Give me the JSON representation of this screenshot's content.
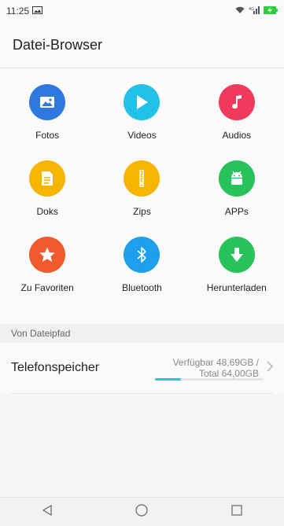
{
  "status": {
    "time": "11:25",
    "network_label": "4G"
  },
  "header": {
    "title": "Datei-Browser"
  },
  "categories": [
    {
      "label": "Fotos",
      "icon": "image-icon",
      "color": "#2f78e0"
    },
    {
      "label": "Videos",
      "icon": "play-icon",
      "color": "#22c2e8"
    },
    {
      "label": "Audios",
      "icon": "music-note-icon",
      "color": "#f0395b"
    },
    {
      "label": "Doks",
      "icon": "document-icon",
      "color": "#f7b500"
    },
    {
      "label": "Zips",
      "icon": "zip-icon",
      "color": "#f7b500"
    },
    {
      "label": "APPs",
      "icon": "android-icon",
      "color": "#27c25a"
    },
    {
      "label": "Zu Favoriten",
      "icon": "star-icon",
      "color": "#f25a2d"
    },
    {
      "label": "Bluetooth",
      "icon": "bluetooth-icon",
      "color": "#1e9fee"
    },
    {
      "label": "Herunterladen",
      "icon": "download-icon",
      "color": "#27c25a"
    }
  ],
  "section": {
    "title": "Von Dateipfad"
  },
  "storage": {
    "name": "Telefonspeicher",
    "available": "Verfügbar 48,69GB /",
    "total": "Total 64,00GB",
    "used_fraction": 0.24
  },
  "navbar": {
    "back": "back-icon",
    "home": "home-icon",
    "recents": "recents-icon"
  }
}
